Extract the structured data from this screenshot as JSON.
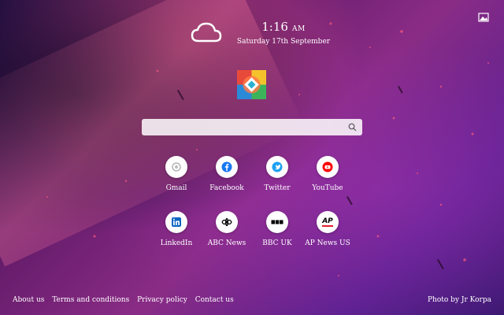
{
  "clock": {
    "time": "1:16",
    "ampm": "AM",
    "date": "Saturday 17th September"
  },
  "search": {
    "placeholder": "",
    "value": ""
  },
  "shortcuts": [
    {
      "label": "Gmail",
      "icon": "gmail-icon",
      "color": "#d44638"
    },
    {
      "label": "Facebook",
      "icon": "facebook-icon",
      "color": "#1877f2"
    },
    {
      "label": "Twitter",
      "icon": "twitter-icon",
      "color": "#1da1f2"
    },
    {
      "label": "YouTube",
      "icon": "youtube-icon",
      "color": "#ff0000"
    },
    {
      "label": "LinkedIn",
      "icon": "linkedin-icon",
      "color": "#0a66c2"
    },
    {
      "label": "ABC News",
      "icon": "abc-news-icon",
      "color": "#000000"
    },
    {
      "label": "BBC UK",
      "icon": "bbc-icon",
      "color": "#000000"
    },
    {
      "label": "AP News US",
      "icon": "ap-news-icon",
      "color": "#e0212b",
      "text": "AP"
    }
  ],
  "footer": {
    "links": [
      "About us",
      "Terms and conditions",
      "Privacy policy",
      "Contact us"
    ],
    "credit": "Photo by Jr Korpa"
  }
}
